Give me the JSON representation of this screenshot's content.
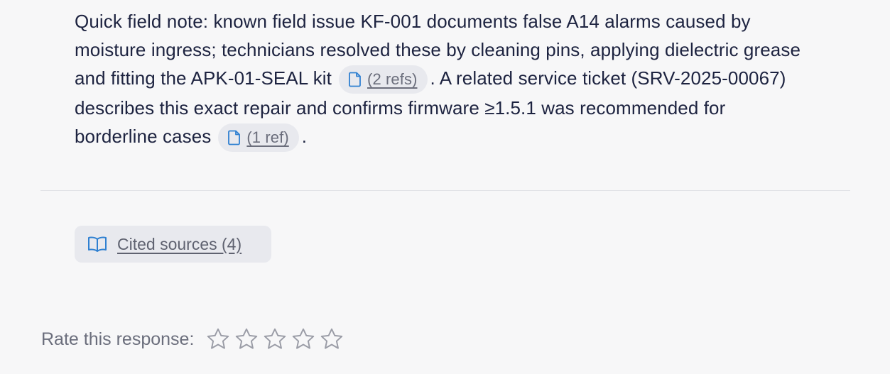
{
  "answer": {
    "part1": "Quick field note: known field issue KF-001 documents false A14 alarms caused by moisture ingress; technicians resolved these by cleaning pins, applying dielectric grease and fitting the APK-01-SEAL kit",
    "ref1_label": "(2 refs)",
    "part2": ". A related service ticket (SRV-2025-00067) describes this exact repair and confirms firmware ≥1.5.1 was recommended for borderline cases",
    "ref2_label": "(1 ref)",
    "part3": "."
  },
  "sources": {
    "label": "Cited sources (4)",
    "icon": "book-icon"
  },
  "rating": {
    "label": "Rate this response:",
    "max_stars": 5,
    "value": 0
  },
  "colors": {
    "accent": "#2f80d1",
    "text": "#1d2340",
    "muted": "#6b6e7c",
    "chip_bg": "#e8e9ee"
  }
}
